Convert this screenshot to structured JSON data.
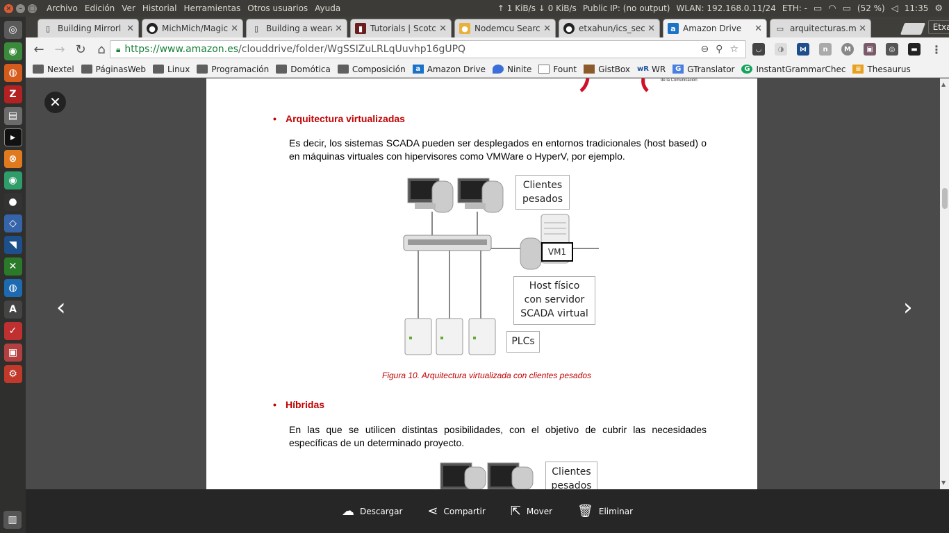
{
  "menubar": {
    "items": [
      "Archivo",
      "Edición",
      "Ver",
      "Historial",
      "Herramientas",
      "Otros usuarios",
      "Ayuda"
    ],
    "net_speed": "↑ 1 KiB/s ↓ 0 KiB/s",
    "public_ip": "Public IP: (no output)",
    "wlan": "WLAN: 192.168.0.11/24",
    "eth": "ETH: -",
    "battery": "(52 %)",
    "clock": "11:35"
  },
  "tabs": [
    {
      "title": "Building Mirrorl",
      "favicon": "doc-icon"
    },
    {
      "title": "MichMich/Magic",
      "favicon": "github-icon"
    },
    {
      "title": "Building a weara",
      "favicon": "doc-icon"
    },
    {
      "title": "Tutorials | Scotc",
      "favicon": "scotch-icon"
    },
    {
      "title": "Nodemcu Searcl",
      "favicon": "gnome-icon"
    },
    {
      "title": "etxahun/ics_sec",
      "favicon": "github-icon"
    },
    {
      "title": "Amazon Drive",
      "favicon": "amazon-icon",
      "active": true
    },
    {
      "title": "arquitecturas.m",
      "favicon": "book-icon"
    }
  ],
  "profile_name": "Etxahun",
  "address": {
    "secure_part": "https://www.amazon.es",
    "path_part": "/clouddrive/folder/WgSSIZuLRLqUuvhp16gUPQ"
  },
  "bookmarks": [
    {
      "label": "Nextel",
      "icon": "folder"
    },
    {
      "label": "PáginasWeb",
      "icon": "folder"
    },
    {
      "label": "Linux",
      "icon": "folder"
    },
    {
      "label": "Programación",
      "icon": "folder"
    },
    {
      "label": "Domótica",
      "icon": "folder"
    },
    {
      "label": "Composición",
      "icon": "folder"
    },
    {
      "label": "Amazon Drive",
      "icon": "amazon"
    },
    {
      "label": "Ninite",
      "icon": "ninite"
    },
    {
      "label": "Fount",
      "icon": "page"
    },
    {
      "label": "GistBox",
      "icon": "gistbox"
    },
    {
      "label": "WR",
      "icon": "wr"
    },
    {
      "label": "GTranslator",
      "icon": "gtranslate"
    },
    {
      "label": "InstantGrammarChec",
      "icon": "grammar"
    },
    {
      "label": "Thesaurus",
      "icon": "thesaurus"
    }
  ],
  "document": {
    "section1_heading": "Arquitectura virtualizadas",
    "section1_text": "Es decir, los sistemas SCADA pueden ser desplegados en entornos tradicionales (host based) o en máquinas virtuales con hipervisores como VMWare o HyperV, por ejemplo.",
    "figure": {
      "clientes_label_1": "Clientes",
      "clientes_label_2": "pesados",
      "vm_label": "VM1",
      "host_label_1": "Host físico",
      "host_label_2": "con servidor",
      "host_label_3": "SCADA virtual",
      "plcs_label": "PLCs",
      "caption": "Figura 10. Arquitectura virtualizada con clientes pesados"
    },
    "section2_heading": "Híbridas",
    "section2_text": "En las que se utilicen distintas posibilidades, con el objetivo de cubrir las necesidades específicas de un determinado proyecto.",
    "figure2": {
      "clientes_label_1": "Clientes",
      "clientes_label_2": "pesados"
    },
    "header_logo_text": "de la Comunicación"
  },
  "actions": {
    "download": "Descargar",
    "share": "Compartir",
    "move": "Mover",
    "delete": "Eliminar"
  }
}
